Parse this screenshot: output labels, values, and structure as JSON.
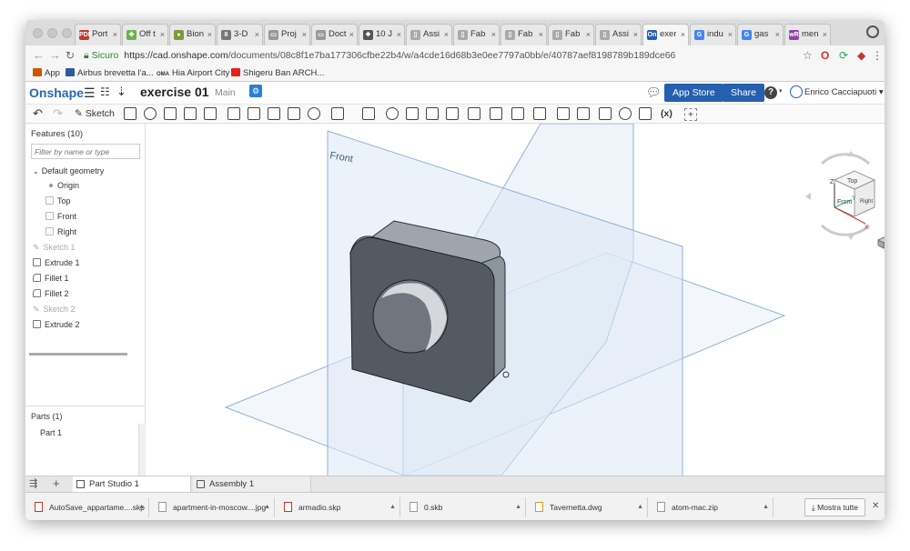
{
  "browser": {
    "tabs": [
      {
        "label": "Port",
        "fav": "PDF",
        "color": "#c0392b"
      },
      {
        "label": "Off t",
        "fav": "✤",
        "color": "#6ab04c"
      },
      {
        "label": "Bion",
        "fav": "●",
        "color": "#7a9a3a"
      },
      {
        "label": "3-D",
        "fav": "8",
        "color": "#777777"
      },
      {
        "label": "Proj",
        "fav": "▭",
        "color": "#999999"
      },
      {
        "label": "Doct",
        "fav": "▭",
        "color": "#999999"
      },
      {
        "label": "10 J",
        "fav": "❖",
        "color": "#555555"
      },
      {
        "label": "Assi",
        "fav": "▯",
        "color": "#aaaaaa"
      },
      {
        "label": "Fab",
        "fav": "▯",
        "color": "#aaaaaa"
      },
      {
        "label": "Fab",
        "fav": "▯",
        "color": "#aaaaaa"
      },
      {
        "label": "Fab",
        "fav": "▯",
        "color": "#aaaaaa"
      },
      {
        "label": "Assi",
        "fav": "▯",
        "color": "#aaaaaa"
      },
      {
        "label": "exer",
        "fav": "On",
        "color": "#2560b0",
        "active": true
      },
      {
        "label": "indu",
        "fav": "G",
        "color": "#4285f4"
      },
      {
        "label": "gas",
        "fav": "G",
        "color": "#4285f4"
      },
      {
        "label": "men",
        "fav": "wR",
        "color": "#8e44ad"
      }
    ],
    "secure_label": "Sicuro",
    "url_host": "https://cad.onshape.com",
    "url_path": "/documents/08c8f1e7ba177306cfbe22b4/w/a4cde16d68b3e0ee7797a0bb/e/40787aef8198789b189dce66",
    "bookmarks": [
      {
        "label": "App",
        "color": "#d35400"
      },
      {
        "label": "Airbus brevetta l'a...",
        "color": "#2c5aa0"
      },
      {
        "label": "Hia Airport City",
        "color": "#333333",
        "prefix": "OMA"
      },
      {
        "label": "Shigeru Ban ARCH...",
        "color": "#e62117"
      }
    ]
  },
  "onshape": {
    "logo": "Onshape",
    "document_name": "exercise 01",
    "branch": "Main",
    "app_store_label": "App Store",
    "share_label": "Share",
    "help_label": "?",
    "user_name": "Enrico Cacciapuoti",
    "toolbar": {
      "sketch_label": "Sketch",
      "variable_label": "(x)"
    }
  },
  "features": {
    "title": "Features (10)",
    "filter_placeholder": "Filter by name or type",
    "default_geometry": "Default geometry",
    "geometry_items": [
      "Origin",
      "Top",
      "Front",
      "Right"
    ],
    "items": [
      {
        "label": "Sketch 1",
        "suppressed": true
      },
      {
        "label": "Extrude 1",
        "suppressed": false
      },
      {
        "label": "Fillet 1",
        "suppressed": false
      },
      {
        "label": "Fillet 2",
        "suppressed": false
      },
      {
        "label": "Sketch 2",
        "suppressed": true
      },
      {
        "label": "Extrude 2",
        "suppressed": false
      }
    ]
  },
  "parts": {
    "title": "Parts (1)",
    "items": [
      "Part 1"
    ]
  },
  "viewport": {
    "plane_label": "Front",
    "viewcube": {
      "top": "Top",
      "front": "Front",
      "right": "Right",
      "axis_z": "Z",
      "axis_y": "Y",
      "axis_x": "X"
    }
  },
  "bottom_tabs": [
    {
      "label": "Part Studio 1",
      "active": true
    },
    {
      "label": "Assembly 1",
      "active": false
    }
  ],
  "downloads": {
    "items": [
      "AutoSave_appartame....skp",
      "apartment-in-moscow....jpg",
      "armadio.skp",
      "0.skb",
      "Tavernetta.dwg",
      "atom-mac.zip"
    ],
    "show_all_label": "Mostra tutte"
  }
}
